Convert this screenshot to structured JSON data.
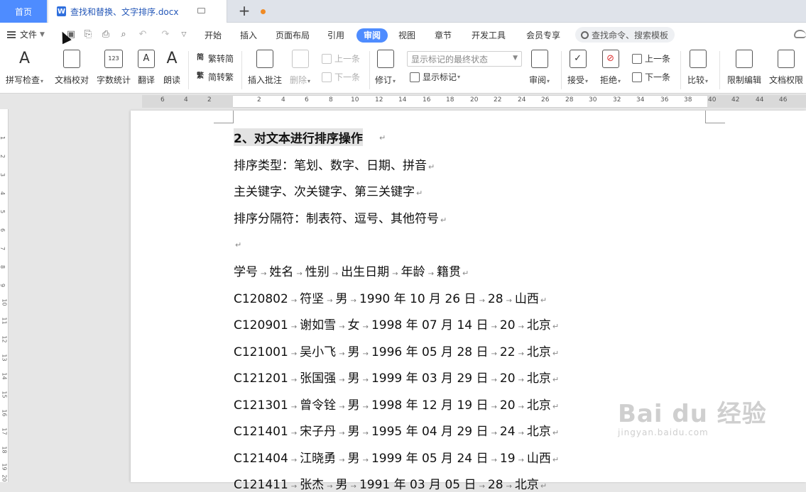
{
  "tabs": {
    "home": "首页",
    "document": "查找和替换、文字排序.docx"
  },
  "menu": {
    "file": "文件",
    "tabs": [
      "开始",
      "插入",
      "页面布局",
      "引用",
      "审阅",
      "视图",
      "章节",
      "开发工具",
      "会员专享"
    ],
    "active_tab": "审阅",
    "search_placeholder": "查找命令、搜索模板"
  },
  "ribbon": {
    "spellcheck": "拼写检查",
    "doc_proof": "文档校对",
    "word_count": "字数统计",
    "translate": "翻译",
    "read_aloud": "朗读",
    "trad_to_simp": "繁转简",
    "simp_to_trad": "简转繁",
    "insert_comment": "插入批注",
    "delete": "删除",
    "prev_comment": "上一条",
    "next_comment": "下一条",
    "track_changes": "修订",
    "display_state": "显示标记的最终状态",
    "show_markup": "显示标记",
    "review": "审阅",
    "accept": "接受",
    "reject": "拒绝",
    "prev_change": "上一条",
    "next_change": "下一条",
    "compare": "比较",
    "restrict_edit": "限制编辑",
    "doc_permissions": "文档权限"
  },
  "ruler": {
    "h_numbers": [
      "6",
      "4",
      "2",
      "2",
      "4",
      "6",
      "8",
      "10",
      "12",
      "14",
      "16",
      "18",
      "20",
      "22",
      "24",
      "26",
      "28",
      "30",
      "32",
      "34",
      "36",
      "38",
      "40",
      "42",
      "44",
      "46"
    ],
    "v_numbers": [
      "1",
      "2",
      "3",
      "4",
      "5",
      "6",
      "7",
      "8",
      "9",
      "10",
      "11",
      "12",
      "13",
      "14",
      "15",
      "16",
      "17",
      "18",
      "19",
      "20"
    ]
  },
  "document": {
    "heading": "2、对文本进行排序操作",
    "lines": [
      "排序类型：笔划、数字、日期、拼音",
      "主关键字、次关键字、第三关键字",
      "排序分隔符：制表符、逗号、其他符号"
    ],
    "table_header": [
      "学号",
      "姓名",
      "性别",
      "出生日期",
      "年龄",
      "籍贯"
    ],
    "rows": [
      [
        "C120802",
        "符坚",
        "男",
        "1990 年 10 月 26 日",
        "28",
        "山西"
      ],
      [
        "C120901",
        "谢如雪",
        "女",
        "1998 年 07 月 14 日",
        "20",
        "北京"
      ],
      [
        "C121001",
        "吴小飞",
        "男",
        "1996 年 05 月 28 日",
        "22",
        "北京"
      ],
      [
        "C121201",
        "张国强",
        "男",
        "1999 年 03 月 29 日",
        "20",
        "北京"
      ],
      [
        "C121301",
        "曾令铨",
        "男",
        "1998 年 12 月 19 日",
        "20",
        "北京"
      ],
      [
        "C121401",
        "宋子丹",
        "男",
        "1995 年 04 月 29 日",
        "24",
        "北京"
      ],
      [
        "C121404",
        "江晓勇",
        "男",
        "1999 年 05 月 24 日",
        "19",
        "山西"
      ],
      [
        "C121411",
        "张杰",
        "男",
        "1991 年 03 月 05 日",
        "28",
        "北京"
      ]
    ]
  },
  "watermark": {
    "brand": "Bai du 经验",
    "url": "jingyan.baidu.com"
  },
  "colors": {
    "accent": "#4e8cff",
    "tab_bg": "#dfe3ea",
    "doc_title": "#2457b8"
  }
}
